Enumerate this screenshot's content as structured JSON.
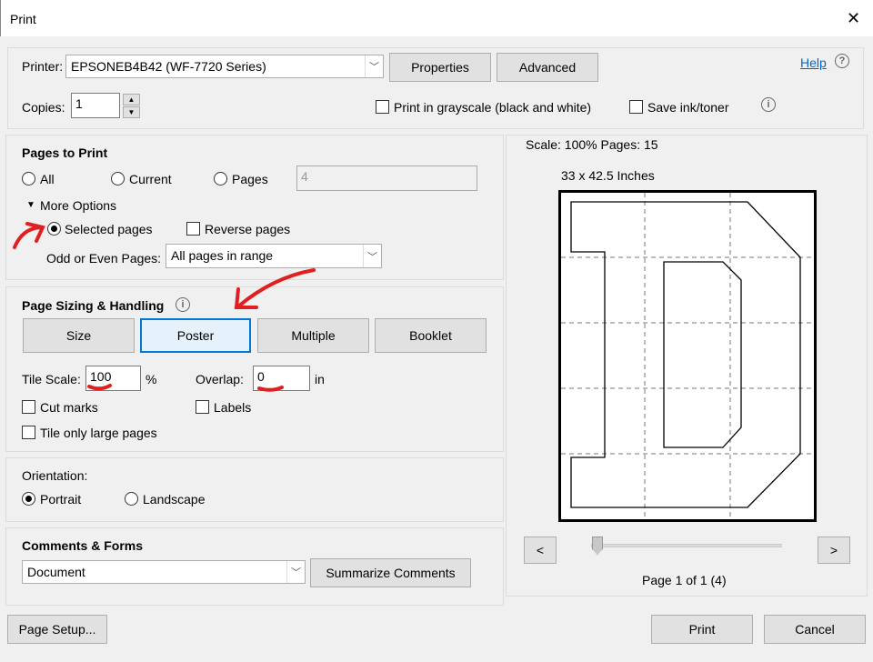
{
  "window": {
    "title": "Print",
    "close": "✕"
  },
  "printer": {
    "label": "Printer:",
    "value": "EPSONEB4B42 (WF-7720 Series)",
    "properties": "Properties",
    "advanced": "Advanced",
    "help": "Help"
  },
  "copies": {
    "label": "Copies:",
    "value": "1",
    "grayscale": "Print in grayscale (black and white)",
    "save_ink": "Save ink/toner"
  },
  "pages": {
    "title": "Pages to Print",
    "all": "All",
    "current": "Current",
    "pages": "Pages",
    "pages_value": "4",
    "more_options": "More Options",
    "selected_pages": "Selected pages",
    "reverse": "Reverse pages",
    "odd_even_label": "Odd or Even Pages:",
    "odd_even_value": "All pages in range"
  },
  "sizing": {
    "title": "Page Sizing & Handling",
    "size": "Size",
    "poster": "Poster",
    "multiple": "Multiple",
    "booklet": "Booklet",
    "tile_scale_label": "Tile Scale:",
    "tile_scale": "100",
    "percent": "%",
    "overlap_label": "Overlap:",
    "overlap": "0",
    "overlap_unit": "in",
    "cut_marks": "Cut marks",
    "labels": "Labels",
    "tile_large": "Tile only large pages"
  },
  "orientation": {
    "title": "Orientation:",
    "portrait": "Portrait",
    "landscape": "Landscape"
  },
  "comments": {
    "title": "Comments & Forms",
    "value": "Document",
    "summarize": "Summarize Comments"
  },
  "preview": {
    "scale": "Scale: 100% Pages: 15",
    "size": "33 x 42.5 Inches",
    "prev": "<",
    "next": ">",
    "page_info": "Page 1 of 1 (4)",
    "slider_value": 0
  },
  "footer": {
    "page_setup": "Page Setup...",
    "print": "Print",
    "cancel": "Cancel"
  },
  "colors": {
    "annotation": "#e02020",
    "selected_border": "#0078d7",
    "help_link": "#0066cc"
  }
}
